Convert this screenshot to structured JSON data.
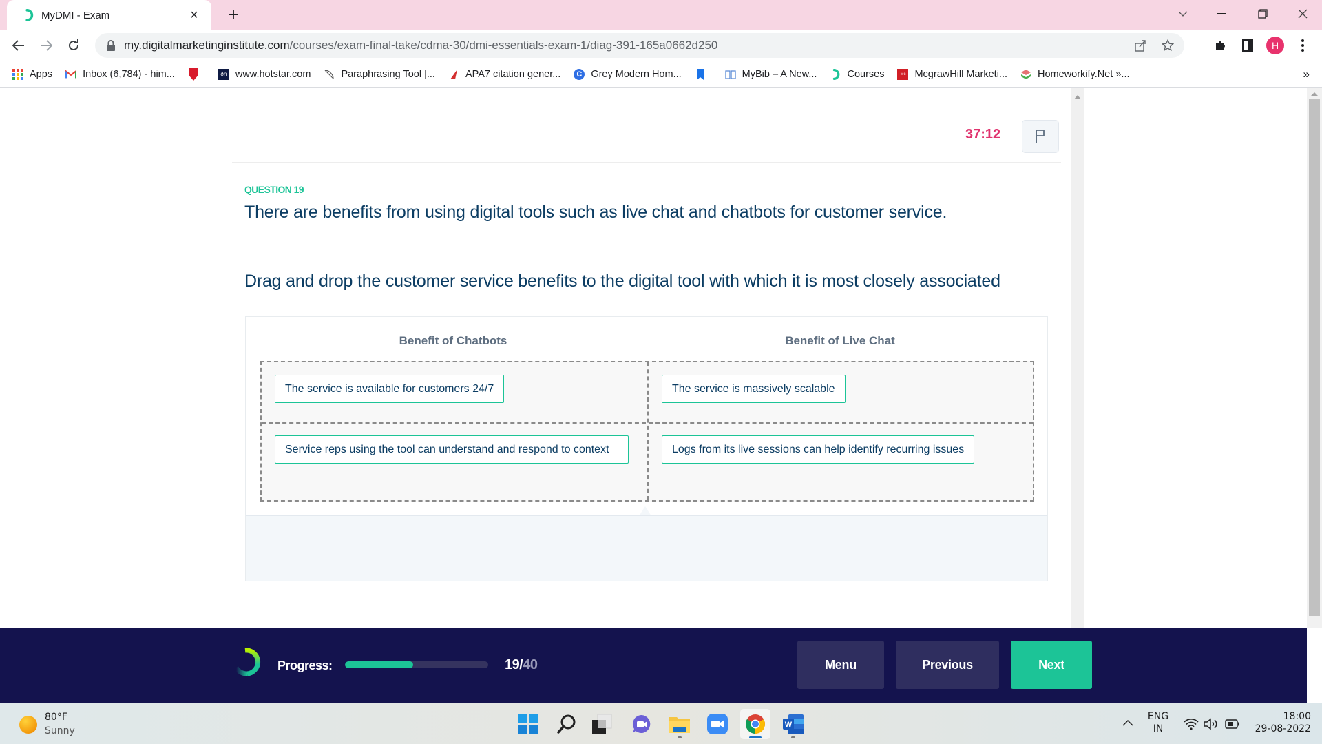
{
  "browser": {
    "tab_title": "MyDMI - Exam",
    "tab_close": "×",
    "new_tab": "+",
    "url_host": "my.digitalmarketinginstitute.com",
    "url_path": "/courses/exam-final-take/cdma-30/dmi-essentials-exam-1/diag-391-165a0662d250",
    "profile_initial": "H",
    "bookmarks": [
      {
        "label": "Apps",
        "icon": "apps-grid-icon"
      },
      {
        "label": "Inbox (6,784) - him...",
        "icon": "gmail-icon"
      },
      {
        "label": "",
        "icon": "red-bookmark-icon"
      },
      {
        "label": "www.hotstar.com",
        "icon": "hotstar-icon"
      },
      {
        "label": "Paraphrasing Tool |...",
        "icon": "quill-icon"
      },
      {
        "label": "APA7 citation gener...",
        "icon": "citation-icon"
      },
      {
        "label": "Grey Modern Hom...",
        "icon": "canva-icon"
      },
      {
        "label": "",
        "icon": "blue-bookmark-icon"
      },
      {
        "label": "MyBib – A New...",
        "icon": "book-icon"
      },
      {
        "label": "Courses",
        "icon": "dmi-icon"
      },
      {
        "label": "McgrawHill Marketi...",
        "icon": "mcgrawhill-icon"
      },
      {
        "label": "Homeworkify.Net »...",
        "icon": "homeworkify-icon"
      }
    ],
    "bookmarks_more": "»"
  },
  "exam": {
    "timer": "37:12",
    "question_number": "QUESTION 19",
    "question_text": "There are benefits from using digital tools such as live chat and chatbots for customer service.",
    "instruction": "Drag and drop the customer service benefits to the digital tool with which it is most closely associated",
    "columns": [
      {
        "heading": "Benefit of Chatbots",
        "items": [
          "The service is available for customers 24/7",
          "Service reps using the tool can understand and respond to context"
        ]
      },
      {
        "heading": "Benefit of Live Chat",
        "items": [
          "The service is massively scalable",
          "Logs from its live sessions can help identify recurring issues"
        ]
      }
    ]
  },
  "footer": {
    "progress_label": "Progress:",
    "progress_current": "19",
    "progress_separator": "/",
    "progress_total": "40",
    "progress_fraction": 0.475,
    "menu_label": "Menu",
    "previous_label": "Previous",
    "next_label": "Next",
    "colors": {
      "accent": "#1cc497",
      "navy": "#14134e",
      "timer": "#e0336e"
    }
  },
  "taskbar": {
    "weather_temp": "80°F",
    "weather_desc": "Sunny",
    "apps": [
      "windows-start",
      "search",
      "task-view",
      "teams-chat",
      "file-explorer",
      "zoom",
      "chrome",
      "word"
    ],
    "lang_line1": "ENG",
    "lang_line2": "IN",
    "time": "18:00",
    "date": "29-08-2022"
  }
}
